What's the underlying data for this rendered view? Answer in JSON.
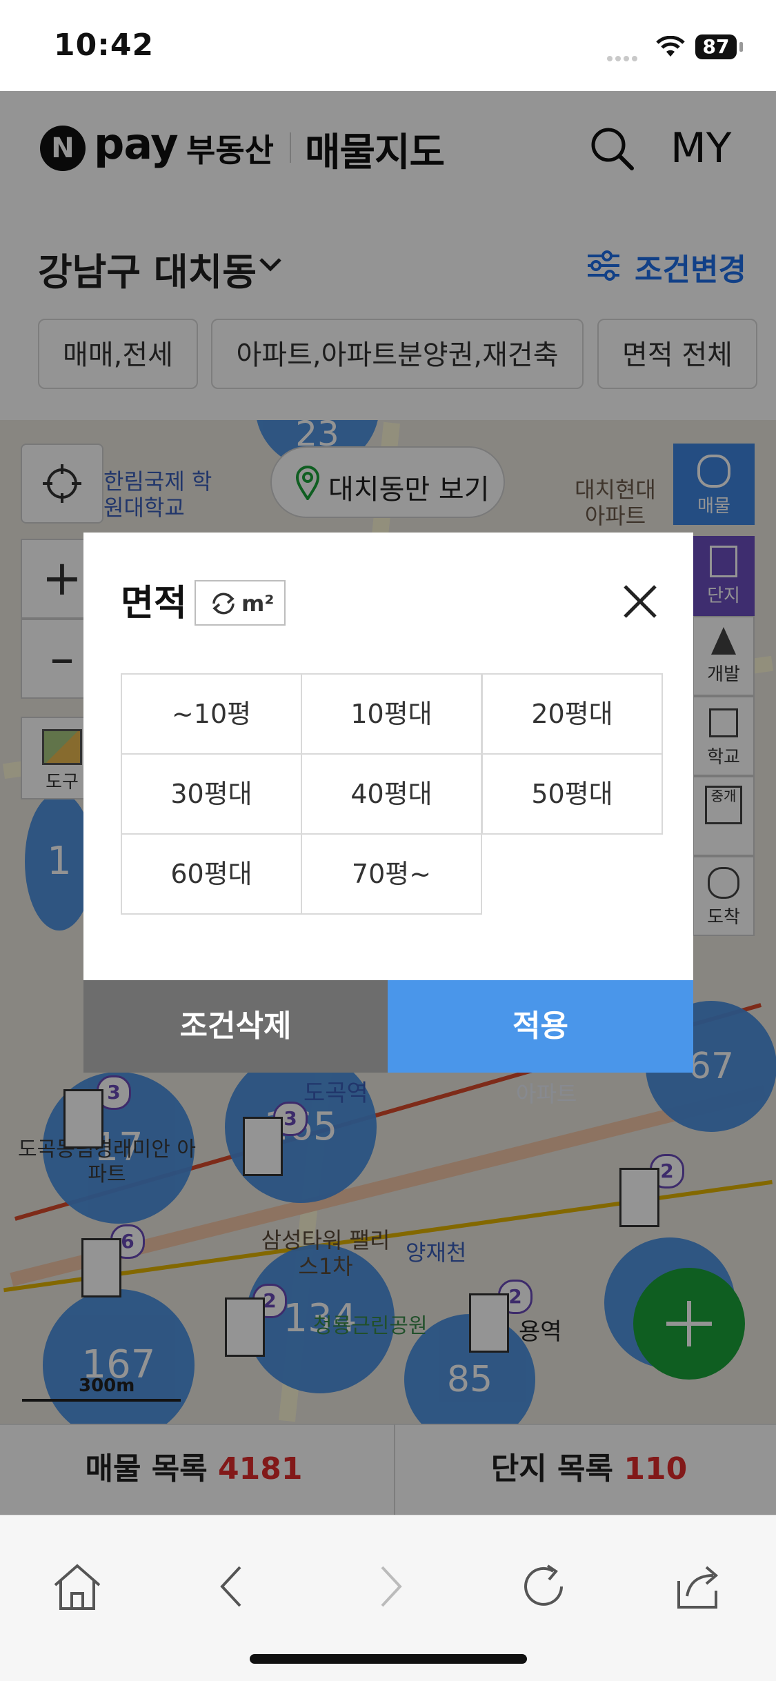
{
  "status": {
    "time": "10:42",
    "battery": "87"
  },
  "header": {
    "logo_n": "N",
    "logo_pay": "pay",
    "logo_service": "부동산",
    "title": "매물지도",
    "my": "MY"
  },
  "filter": {
    "region": "강남구 대치동",
    "change_condition": "조건변경",
    "chips": [
      "매매,전세",
      "아파트,아파트분양권,재건축",
      "면적 전체"
    ]
  },
  "map": {
    "dong_only": "대치동만 보기",
    "side_right": [
      "매물",
      "단지",
      "개발",
      "학교",
      "중개",
      "도착"
    ],
    "side_left_tool": "도구",
    "place_labels": [
      "한림국제 학원대학교",
      "대치현대 아파트",
      "도곡역",
      "도곡동림경래미안 아파트",
      "삼성타워 팰리스1차",
      "양재천",
      "청룡근린공원",
      "용역",
      "아파트"
    ],
    "clusters": [
      "23",
      "17",
      "165",
      "134",
      "167",
      "85",
      "67",
      "1"
    ],
    "badges": [
      "3",
      "3",
      "6",
      "2",
      "2",
      "2"
    ],
    "scale": "300m"
  },
  "modal": {
    "title": "면적",
    "unit_toggle": "m²",
    "options": [
      "~10평",
      "10평대",
      "20평대",
      "30평대",
      "40평대",
      "50평대",
      "60평대",
      "70평~"
    ],
    "reset": "조건삭제",
    "apply": "적용"
  },
  "tabs": {
    "listings_label": "매물 목록",
    "listings_count": "4181",
    "complex_label": "단지 목록",
    "complex_count": "110"
  },
  "colors": {
    "accent": "#1e6ee8",
    "apply": "#4a96ea",
    "reset": "#6d6d6d",
    "count": "#e02b2b",
    "cluster": "#4a8fe0",
    "fab": "#1aa33a"
  }
}
